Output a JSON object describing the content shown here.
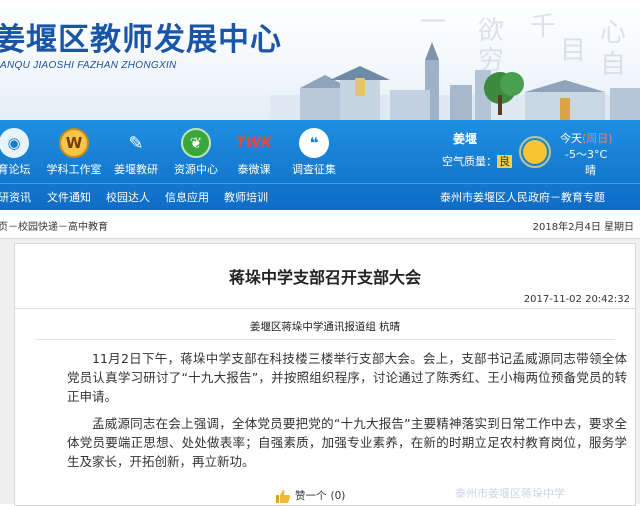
{
  "banner": {
    "title": "姜堰区教师发展中心",
    "subtitle": "ANQU JIAOSHI FAZHAN ZHONGXIN",
    "calligraphy": [
      "一",
      "欲",
      "穷",
      "心",
      "千",
      "目",
      "自"
    ]
  },
  "nav": {
    "items": [
      {
        "label": "育论坛",
        "icon": "forum-icon"
      },
      {
        "label": "学科工作室",
        "icon": "wow-shield-icon"
      },
      {
        "label": "姜堰教研",
        "icon": "book-icon"
      },
      {
        "label": "资源中心",
        "icon": "leaf-icon"
      },
      {
        "label": "泰微课",
        "icon": "twk-logo-icon",
        "glyph": "TWK"
      },
      {
        "label": "调查征集",
        "icon": "chat-icon"
      }
    ],
    "links": [
      "研资讯",
      "文件通知",
      "校园达人",
      "信息应用",
      "教师培训"
    ],
    "gov_link": "泰州市姜堰区人民政府－教育专题"
  },
  "weather": {
    "city": "姜堰",
    "air_quality_label": "空气质量：",
    "air_quality_value": "良",
    "day": "今天",
    "day_paren": "(周日)",
    "temperature": "-5～3°C",
    "condition": "晴"
  },
  "breadcrumb": {
    "path": "页－校园快递－高中教育",
    "date": "2018年2月4日  星期日"
  },
  "article": {
    "title": "蒋垛中学支部召开支部大会",
    "timestamp": "2017-11-02  20:42:32",
    "author": "姜堰区蒋垛中学通讯报道组  杭晴",
    "paragraphs": [
      "11月2日下午，蒋垛中学支部在科技楼三楼举行支部大会。会上，支部书记孟威源同志带领全体党员认真学习研讨了“十九大报告”，并按照组织程序，讨论通过了陈秀红、王小梅两位预备党员的转正申请。",
      "孟威源同志在会上强调，全体党员要把党的“十九大报告”主要精神落实到日常工作中去，要求全体党员要端正思想、处处做表率；自强素质，加强专业素养，在新的时期立足农村教育岗位，服务学生及家长，开拓创新，再立新功。"
    ],
    "like_label": "赞一个",
    "like_count": "(0)",
    "watermark": "泰州市姜堰区蒋垛中学"
  },
  "colors": {
    "nav_blue": "#1478d4",
    "title_blue": "#1a56a8"
  }
}
